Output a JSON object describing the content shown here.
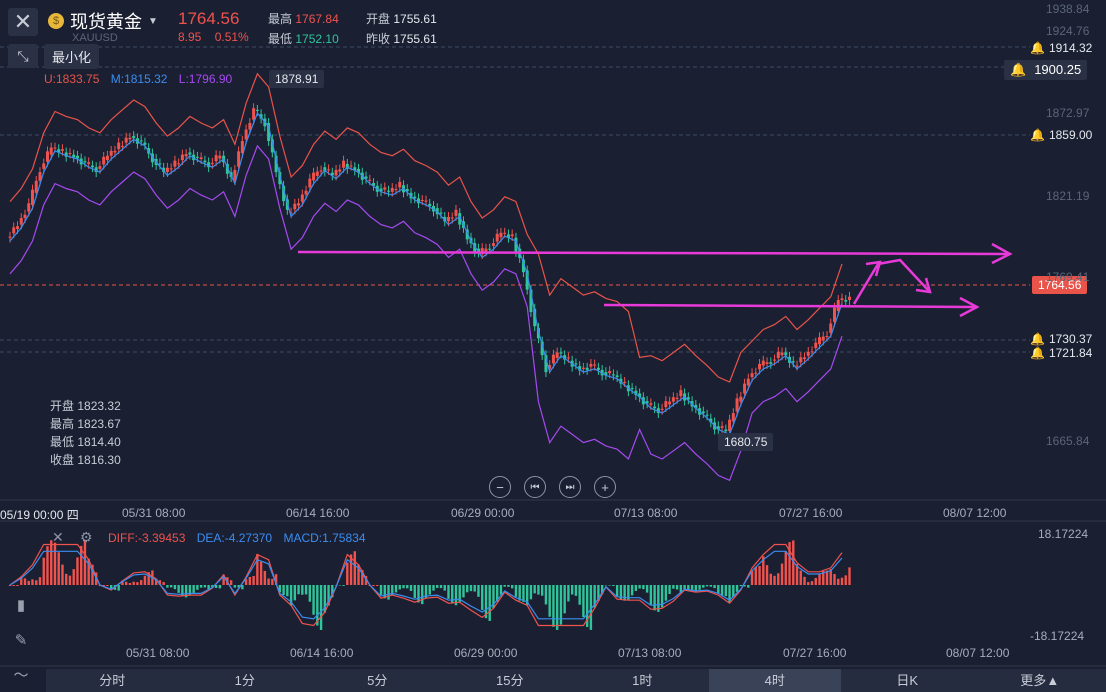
{
  "header": {
    "close_icon": "close-icon",
    "minimize_icon": "compress-icon",
    "minimize_tooltip": "最小化",
    "symbol_name": "现货黄金",
    "symbol_code": "XAUUSD",
    "last_price": "1764.56",
    "change": "8.95",
    "change_pct": "0.51%",
    "high_label": "最高",
    "high_value": "1767.84",
    "low_label": "最低",
    "low_value": "1752.10",
    "open_label": "开盘",
    "open_value": "1755.61",
    "prev_label": "昨收",
    "prev_value": "1755.61"
  },
  "bollinger": {
    "upper": "U:1833.75",
    "middle": "M:1815.32",
    "lower": "L:1796.90"
  },
  "cursor_ohlc": {
    "open_label": "开盘",
    "open": "1823.32",
    "high_label": "最高",
    "high": "1823.67",
    "low_label": "最低",
    "low": "1814.40",
    "close_label": "收盘",
    "close": "1816.30"
  },
  "price_labels": {
    "high_marker": "1878.91",
    "low_marker": "1680.75",
    "current": "1764.56"
  },
  "alerts": [
    {
      "value": "1914.32"
    },
    {
      "value": "1900.25"
    },
    {
      "value": "1859.00"
    },
    {
      "value": "1730.37"
    },
    {
      "value": "1721.84"
    }
  ],
  "y_axis_ticks": [
    "1938.84",
    "1924.76",
    "1872.97",
    "1821.19",
    "1769.41",
    "1665.84"
  ],
  "x_axis": {
    "cursor_date": "05/19 00:00 四",
    "ticks": [
      "05/31 08:00",
      "06/14 16:00",
      "06/29 00:00",
      "07/13 08:00",
      "07/27 16:00",
      "08/07 12:00"
    ]
  },
  "nav_buttons": {
    "zoom_out": "−",
    "prev": "⏮",
    "next": "⏭",
    "zoom_in": "+"
  },
  "macd": {
    "diff": "DIFF:-3.39453",
    "dea": "DEA:-4.27370",
    "macd": "MACD:1.75834",
    "top": "18.17224",
    "bottom": "-18.17224",
    "x_ticks": [
      "05/31 08:00",
      "06/14 16:00",
      "06/29 00:00",
      "07/13 08:00",
      "07/27 16:00",
      "08/07 12:00"
    ]
  },
  "timeframes": [
    "分时",
    "1分",
    "5分",
    "15分",
    "1时",
    "4时",
    "日K",
    "更多"
  ],
  "timeframe_selected": "4时",
  "colors": {
    "up": "#f0524d",
    "down": "#2fc49a",
    "upper_band": "#e8534a",
    "middle_band": "#3b8df0",
    "lower_band": "#a64af0",
    "annotation": "#e83ad9"
  },
  "chart_data": {
    "type": "candlestick",
    "title": "现货黄金 XAUUSD 4时",
    "ylim": [
      1640,
      1945
    ],
    "x_labels": [
      "05/31 08:00",
      "06/14 16:00",
      "06/29 00:00",
      "07/13 08:00",
      "07/27 16:00",
      "08/07 12:00"
    ],
    "close_path": [
      1800,
      1808,
      1820,
      1842,
      1855,
      1852,
      1850,
      1845,
      1842,
      1850,
      1856,
      1862,
      1858,
      1848,
      1840,
      1845,
      1852,
      1848,
      1845,
      1850,
      1835,
      1860,
      1878,
      1870,
      1840,
      1815,
      1822,
      1835,
      1843,
      1838,
      1845,
      1842,
      1835,
      1830,
      1828,
      1832,
      1825,
      1822,
      1818,
      1810,
      1815,
      1800,
      1790,
      1795,
      1803,
      1800,
      1780,
      1745,
      1720,
      1730,
      1725,
      1720,
      1722,
      1718,
      1716,
      1710,
      1705,
      1698,
      1695,
      1700,
      1705,
      1698,
      1692,
      1685,
      1682,
      1700,
      1715,
      1722,
      1725,
      1730,
      1722,
      1728,
      1735,
      1742,
      1762
    ],
    "bollinger_last": {
      "upper": 1833.75,
      "middle": 1815.32,
      "lower": 1796.9
    },
    "annotations": [
      "horizontal arrow at ~1785",
      "horizontal arrow at ~1758",
      "arrow up-then-down near 1770-1785"
    ],
    "macd_series": {
      "diff_last": -3.39453,
      "dea_last": -4.2737,
      "macd_last": 1.75834,
      "range": [
        -18.17224,
        18.17224
      ]
    }
  }
}
